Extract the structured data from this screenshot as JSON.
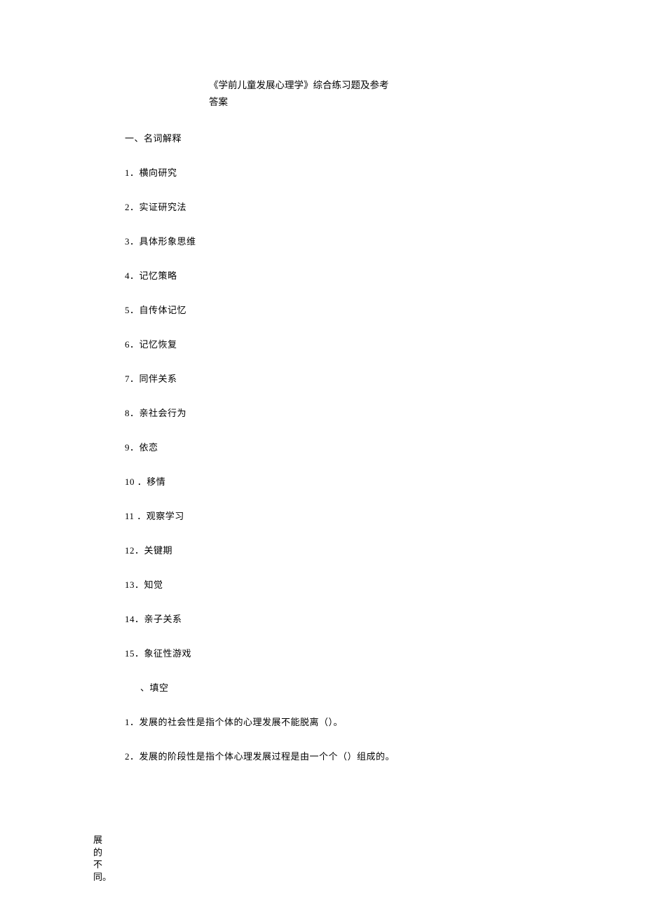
{
  "title_line1": "《学前儿童发展心理学》综合练习题及参考",
  "title_line2": "答案",
  "section1": {
    "heading": "一、名词解释",
    "items": [
      "1．横向研究",
      "2．实证研究法",
      "3．具体形象思维",
      "4．记忆策略",
      "5．自传体记忆",
      "6．记忆恢复",
      "7．同伴关系",
      "8．亲社会行为",
      "9．依恋",
      "10 ．移情",
      "11 ．观察学习",
      "12．关键期",
      "13．知觉",
      "14．亲子关系",
      "15．象征性游戏"
    ]
  },
  "section2": {
    "heading": "、填空",
    "items": [
      "1．发展的社会性是指个体的心理发展不能脱离（）。",
      "2．发展的阶段性是指个体心理发展过程是由一个个（）组成的。"
    ]
  },
  "vertical_fragment": "展的不同。"
}
